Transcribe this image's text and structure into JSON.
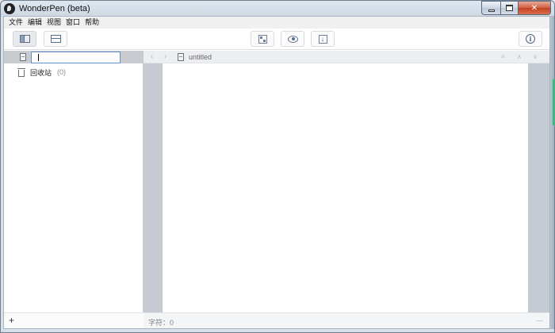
{
  "window": {
    "title": "WonderPen (beta)",
    "controls": {
      "minimize": "minimize",
      "maximize": "maximize",
      "close_glyph": "✕"
    }
  },
  "menubar": {
    "items": [
      "文件",
      "编辑",
      "视图",
      "窗口",
      "帮助"
    ]
  },
  "toolbar": {
    "buttons": [
      {
        "name": "toggle-sidebar",
        "icon": "sidebar-icon"
      },
      {
        "name": "split-view",
        "icon": "split-icon"
      },
      {
        "name": "focus-mode",
        "icon": "expand-icon"
      },
      {
        "name": "preview",
        "icon": "eye-icon"
      },
      {
        "name": "export",
        "icon": "download-icon"
      },
      {
        "name": "info",
        "icon": "info-icon"
      }
    ],
    "info_glyph": "i",
    "download_glyph": "↓"
  },
  "sidebar": {
    "search": {
      "value": "",
      "placeholder": ""
    },
    "trash": {
      "label": "回收站",
      "count": "(0)"
    },
    "add_label": "+"
  },
  "editor": {
    "nav_back": "‹",
    "nav_forward": "›",
    "doc_title": "untitled",
    "header_controls": [
      "≡",
      "∧",
      "∨"
    ],
    "char_count_label": "字符：0",
    "footer_dash": "—"
  },
  "colors": {
    "editor_gutter": "#c6cad3",
    "sidebar_header": "#c8cbd0",
    "accent_green": "#3fb87f"
  }
}
